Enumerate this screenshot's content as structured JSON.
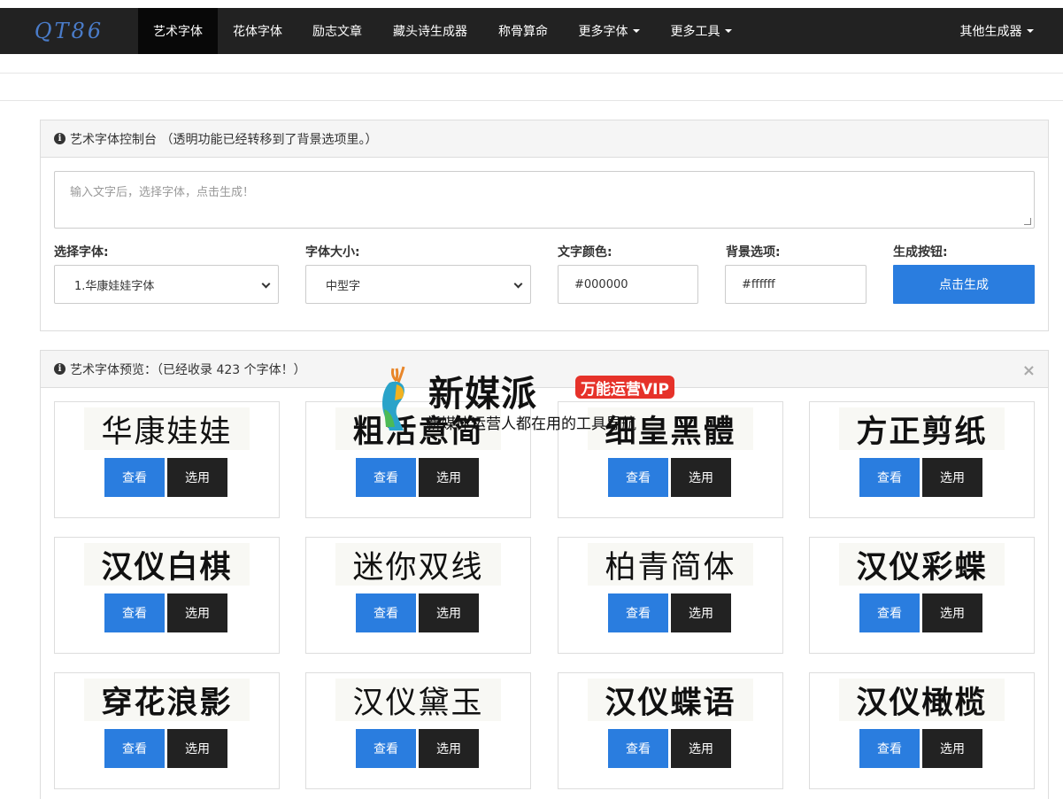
{
  "nav": {
    "brand": "QT86",
    "items": [
      "艺术字体",
      "花体字体",
      "励志文章",
      "藏头诗生成器",
      "称骨算命",
      "更多字体",
      "更多工具"
    ],
    "right": "其他生成器"
  },
  "control": {
    "heading": "艺术字体控制台 （透明功能已经转移到了背景选项里。）",
    "placeholder": "输入文字后，选择字体，点击生成！",
    "labels": {
      "font": "选择字体:",
      "size": "字体大小:",
      "color": "文字颜色:",
      "bg": "背景选项:",
      "button": "生成按钮:"
    },
    "font_value": "1.华康娃娃字体",
    "size_value": "中型字",
    "color_value": "#000000",
    "bg_value": "#ffffff",
    "generate": "点击生成"
  },
  "preview": {
    "heading": "艺术字体预览：（已经收录 423 个字体！）",
    "close": "×",
    "view_label": "查看",
    "pick_label": "选用",
    "cards": [
      {
        "text": "华康娃娃"
      },
      {
        "text": "粗活意简"
      },
      {
        "text": "细皇黑體"
      },
      {
        "text": "方正剪纸"
      },
      {
        "text": "汉仪白棋"
      },
      {
        "text": "迷你双线"
      },
      {
        "text": "柏青简体"
      },
      {
        "text": "汉仪彩蝶"
      },
      {
        "text": "穿花浪影"
      },
      {
        "text": "汉仪黛玉"
      },
      {
        "text": "汉仪蝶语"
      },
      {
        "text": "汉仪橄榄"
      }
    ]
  },
  "watermark": {
    "title": "新媒派",
    "badge": "万能运营VIP",
    "subtitle": "新媒体运营人都在用的工具导航"
  },
  "colors": {
    "navbar": "#222222",
    "accent": "#2a7ddf",
    "dark_button": "#222222"
  }
}
